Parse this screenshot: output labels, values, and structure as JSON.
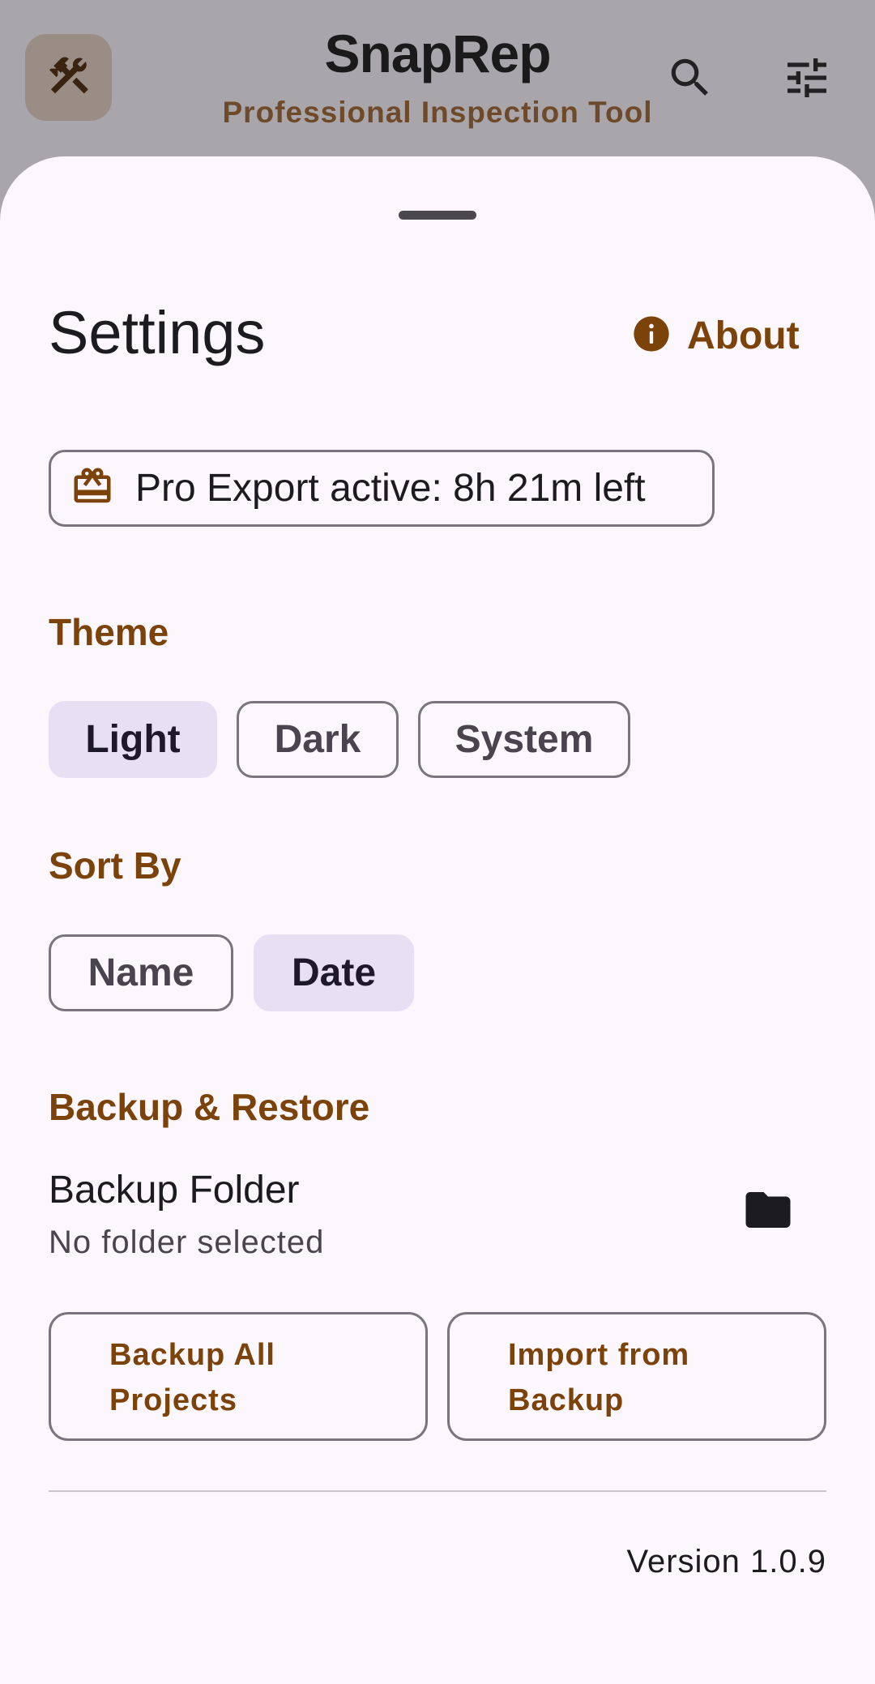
{
  "app_bar": {
    "title": "SnapRep",
    "subtitle": "Professional Inspection Tool",
    "leading_icon": "hammer-wrench-icon",
    "actions": [
      "search-icon",
      "tune-icon"
    ]
  },
  "settings_sheet": {
    "title": "Settings",
    "about_label": "About",
    "pro_status": "Pro Export active: 8h 21m left",
    "theme": {
      "heading": "Theme",
      "options": [
        "Light",
        "Dark",
        "System"
      ],
      "selected": "Light"
    },
    "sort_by": {
      "heading": "Sort By",
      "options": [
        "Name",
        "Date"
      ],
      "selected": "Date"
    },
    "backup": {
      "heading": "Backup & Restore",
      "folder_title": "Backup Folder",
      "folder_status": "No folder selected",
      "backup_all_line1": "Backup All",
      "backup_all_line2": "Projects",
      "import_line1": "Import from",
      "import_line2": "Backup"
    },
    "version": "Version 1.0.9"
  },
  "colors": {
    "accent": "#7b4309",
    "scrim": "#a9a6ab",
    "sheet_bg": "#fcf7fc",
    "selected_segment": "#e7e0f4",
    "outline": "#79747e"
  }
}
